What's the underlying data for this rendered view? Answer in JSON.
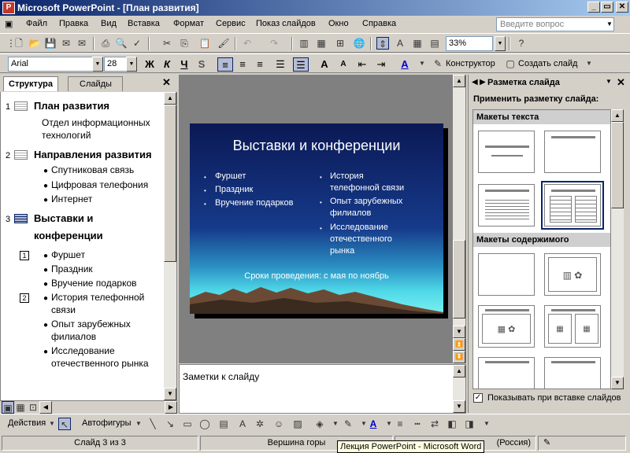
{
  "window": {
    "title": "Microsoft PowerPoint - [План развития]",
    "app_icon": "P"
  },
  "menubar": {
    "items": [
      "Файл",
      "Правка",
      "Вид",
      "Вставка",
      "Формат",
      "Сервис",
      "Показ слайдов",
      "Окно",
      "Справка"
    ],
    "help_placeholder": "Введите вопрос"
  },
  "toolbar": {
    "zoom": "33%"
  },
  "format": {
    "font_name": "Arial",
    "font_size": "28",
    "design_label": "Конструктор",
    "new_slide_label": "Создать слайд"
  },
  "outline": {
    "tabs": [
      "Структура",
      "Слайды"
    ],
    "slides": [
      {
        "num": "1",
        "title": "План развития",
        "text": [
          "Отдел информационных",
          "технологий"
        ]
      },
      {
        "num": "2",
        "title": "Направления развития",
        "bullets": [
          "Спутниковая связь",
          "Цифровая телефония",
          "Интернет"
        ]
      },
      {
        "num": "3",
        "title_lines": [
          "Выставки и",
          "конференции"
        ],
        "group1_num": "1",
        "group1": [
          "Фуршет",
          "Праздник",
          "Вручение подарков"
        ],
        "group2_num": "2",
        "group2": [
          "История телефонной",
          "связи",
          "Опыт зарубежных",
          "филиалов",
          "Исследование",
          "отечественного рынка"
        ]
      }
    ]
  },
  "slide": {
    "title": "Выставки и конференции",
    "left_bullets": [
      "Фуршет",
      "Праздник",
      "Вручение подарков"
    ],
    "right_bullets": [
      [
        "История",
        "телефонной связи"
      ],
      [
        "Опыт зарубежных",
        "филиалов"
      ],
      [
        "Исследование",
        "отечественного",
        "рынка"
      ]
    ],
    "footer": "Сроки проведения: с мая по ноябрь"
  },
  "notes": {
    "placeholder": "Заметки к слайду"
  },
  "task_pane": {
    "title": "Разметка слайда",
    "apply_label": "Применить разметку слайда:",
    "section_text": "Макеты текста",
    "section_content": "Макеты содержимого",
    "show_on_insert": "Показывать при вставке слайдов",
    "show_on_insert_checked": true
  },
  "drawbar": {
    "actions_label": "Действия",
    "autoshapes_label": "Автофигуры"
  },
  "status": {
    "slide_count": "Слайд 3 из 3",
    "design": "Вершина горы",
    "language": "(Россия)"
  },
  "tooltip": "Лекция PowerPoint - Microsoft Word",
  "colors": {
    "title_gradient_start": "#0a246a",
    "slide_top": "#0b1955",
    "slide_glow": "#4fd8e8"
  }
}
